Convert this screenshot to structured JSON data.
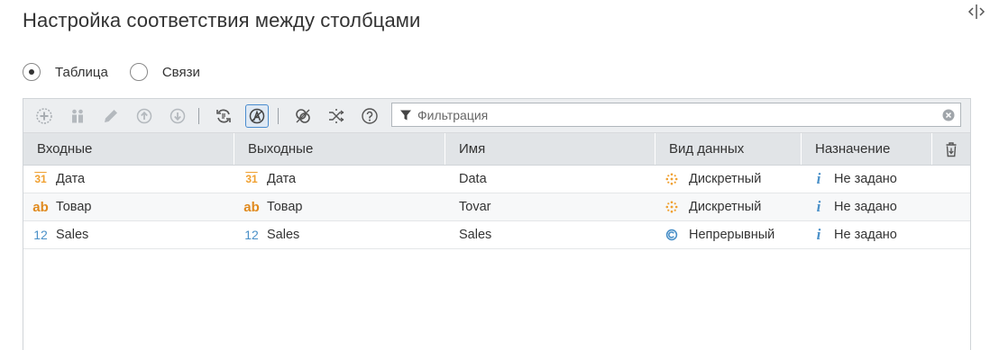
{
  "page": {
    "title": "Настройка соответствия между столбцами"
  },
  "mode": {
    "options": [
      {
        "label": "Таблица",
        "checked": true
      },
      {
        "label": "Связи",
        "checked": false
      }
    ]
  },
  "toolbar": {
    "buttons": [
      {
        "icon": "add-icon",
        "enabled": false
      },
      {
        "icon": "group-icon",
        "enabled": false
      },
      {
        "icon": "edit-icon",
        "enabled": false
      },
      {
        "icon": "move-up-icon",
        "enabled": false
      },
      {
        "icon": "move-down-icon",
        "enabled": false
      },
      {
        "icon": "sync-icon",
        "enabled": true
      },
      {
        "icon": "auto-map-icon",
        "enabled": true,
        "active": true
      },
      {
        "icon": "link-icon",
        "enabled": true
      },
      {
        "icon": "shuffle-icon",
        "enabled": true
      },
      {
        "icon": "help-icon",
        "enabled": true
      }
    ],
    "filter_placeholder": "Фильтрация",
    "filter_value": ""
  },
  "table": {
    "columns": [
      "Входные",
      "Выходные",
      "Имя",
      "Вид данных",
      "Назначение"
    ],
    "rows": [
      {
        "input_type": "date",
        "input_icon_text": "31",
        "input": "Дата",
        "output_type": "date",
        "output_icon_text": "31",
        "output": "Дата",
        "name": "Data",
        "kind_icon": "discrete-icon",
        "kind": "Дискретный",
        "purpose": "Не задано"
      },
      {
        "input_type": "string",
        "input_icon_text": "ab",
        "input": "Товар",
        "output_type": "string",
        "output_icon_text": "ab",
        "output": "Товар",
        "name": "Tovar",
        "kind_icon": "discrete-icon",
        "kind": "Дискретный",
        "purpose": "Не задано"
      },
      {
        "input_type": "number",
        "input_icon_text": "12",
        "input": "Sales",
        "output_type": "number",
        "output_icon_text": "12",
        "output": "Sales",
        "name": "Sales",
        "kind_icon": "continuous-icon",
        "kind": "Непрерывный",
        "purpose": "Не задано"
      }
    ]
  },
  "colors": {
    "accent": "#4a90c8",
    "orange": "#f0a030",
    "header_bg": "#e1e4e7",
    "toolbar_bg": "#eceef0"
  }
}
